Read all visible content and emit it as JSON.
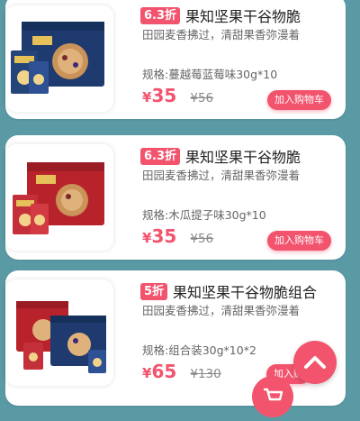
{
  "products": [
    {
      "discount": "6.3折",
      "name": "果知坚果干谷物脆",
      "slogan": "田园麦香拂过，清甜果香弥漫着",
      "spec": "规格:蔓越莓蓝莓味30g*10",
      "currency": "¥",
      "price": "35",
      "original_price": "¥56",
      "cart_label": "加入购物车",
      "box_color": "#1e3a6e"
    },
    {
      "discount": "6.3折",
      "name": "果知坚果干谷物脆",
      "slogan": "田园麦香拂过，清甜果香弥漫着",
      "spec": "规格:木瓜提子味30g*10",
      "currency": "¥",
      "price": "35",
      "original_price": "¥56",
      "cart_label": "加入购物车",
      "box_color": "#b8232b"
    },
    {
      "discount": "5折",
      "name": "果知坚果干谷物脆组合",
      "slogan": "田园麦香拂过，清甜果香弥漫着",
      "spec": "规格:组合装30g*10*2",
      "currency": "¥",
      "price": "65",
      "original_price": "¥130",
      "cart_label": "加入购",
      "box_color": "#b8232b"
    }
  ],
  "floating": {
    "back_to_top_icon": "chevron-up-icon",
    "cart_icon": "cart-icon"
  },
  "colors": {
    "accent": "#f2536d",
    "background": "#5a9aa5"
  }
}
